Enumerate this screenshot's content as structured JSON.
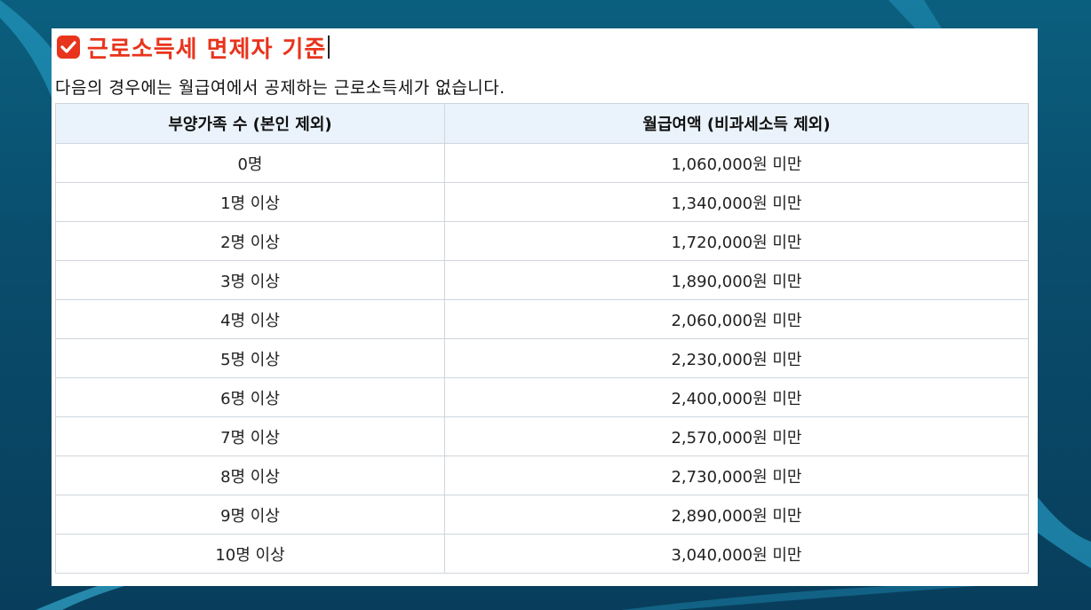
{
  "title": "근로소득세 면제자 기준",
  "description": "다음의 경우에는 월급여에서 공제하는 근로소득세가 없습니다.",
  "table": {
    "headers": [
      "부양가족 수 (본인 제외)",
      "월급여액 (비과세소득 제외)"
    ],
    "rows": [
      [
        "0명",
        "1,060,000원 미만"
      ],
      [
        "1명 이상",
        "1,340,000원 미만"
      ],
      [
        "2명 이상",
        "1,720,000원 미만"
      ],
      [
        "3명 이상",
        "1,890,000원 미만"
      ],
      [
        "4명 이상",
        "2,060,000원 미만"
      ],
      [
        "5명 이상",
        "2,230,000원 미만"
      ],
      [
        "6명 이상",
        "2,400,000원 미만"
      ],
      [
        "7명 이상",
        "2,570,000원 미만"
      ],
      [
        "8명 이상",
        "2,730,000원 미만"
      ],
      [
        "9명 이상",
        "2,890,000원 미만"
      ],
      [
        "10명 이상",
        "3,040,000원 미만"
      ]
    ]
  },
  "icons": {
    "title_icon": "check-box-icon"
  },
  "colors": {
    "accent": "#e8341c",
    "header_bg": "#eaf3fb",
    "border": "#cfd6dc"
  }
}
